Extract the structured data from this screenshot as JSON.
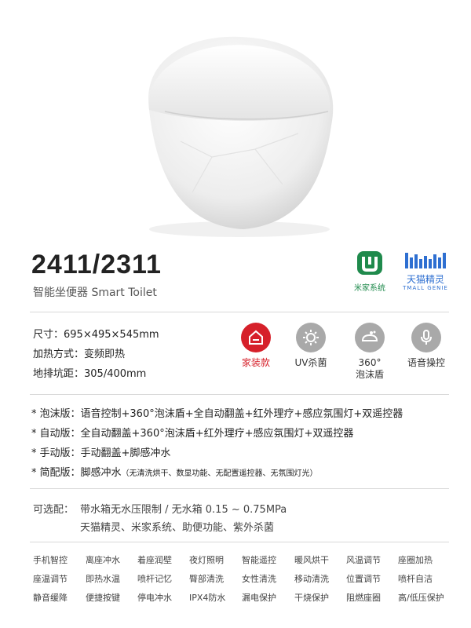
{
  "product": {
    "model": "2411/2311",
    "subtitle": "智能坐便器 Smart Toilet"
  },
  "logos": {
    "mijia_label": "米家系统",
    "tmall_label": "天猫精灵",
    "tmall_sub": "TMALL GENIE"
  },
  "specs": [
    {
      "label": "尺寸：",
      "value": "695×495×545mm"
    },
    {
      "label": "加热方式：",
      "value": "变频即热"
    },
    {
      "label": "地排坑距：",
      "value": "305/400mm"
    }
  ],
  "features": [
    {
      "label": "家装款",
      "icon": "house-icon",
      "highlight": true
    },
    {
      "label": "UV杀菌",
      "icon": "sun-icon",
      "highlight": false
    },
    {
      "label_line1": "360°",
      "label_line2": "泡沫盾",
      "icon": "foam-shield-icon",
      "highlight": false
    },
    {
      "label": "语音操控",
      "icon": "microphone-icon",
      "highlight": false
    }
  ],
  "versions": [
    {
      "star": "*",
      "name": "泡沫版：",
      "desc": "语音控制+360°泡沫盾+全自动翻盖+红外理疗+感应氛围灯+双遥控器"
    },
    {
      "star": "*",
      "name": "自动版：",
      "desc": "全自动翻盖+360°泡沫盾+红外理疗+感应氛围灯+双遥控器"
    },
    {
      "star": "*",
      "name": "手动版：",
      "desc": "手动翻盖+脚感冲水"
    },
    {
      "star": "*",
      "name": "简配版：",
      "desc": "脚感冲水",
      "note": "（无清洗烘干、数显功能、无配置遥控器、无氛围灯光）"
    }
  ],
  "optional": {
    "label": "可选配：",
    "line1": "带水箱无水压限制 / 无水箱 0.15 ~ 0.75MPa",
    "line2": "天猫精灵、米家系统、助便功能、紫外杀菌"
  },
  "function_grid": [
    [
      "手机智控",
      "离座冲水",
      "着座润壁",
      "夜灯照明",
      "智能遥控",
      "暖风烘干",
      "风温调节",
      "座圈加热"
    ],
    [
      "座温调节",
      "即热水温",
      "喷杆记忆",
      "臀部清洗",
      "女性清洗",
      "移动清洗",
      "位置调节",
      "喷杆自洁"
    ],
    [
      "静音缓降",
      "便捷按键",
      "停电冲水",
      "IPX4防水",
      "漏电保护",
      "干烧保护",
      "阻燃座圈",
      "高/低压保护"
    ]
  ],
  "colors": {
    "accent_red": "#d6202a",
    "icon_grey": "#a9a9a9",
    "mijia_green": "#1f8a4c",
    "tmall_blue": "#2e6fd1"
  }
}
